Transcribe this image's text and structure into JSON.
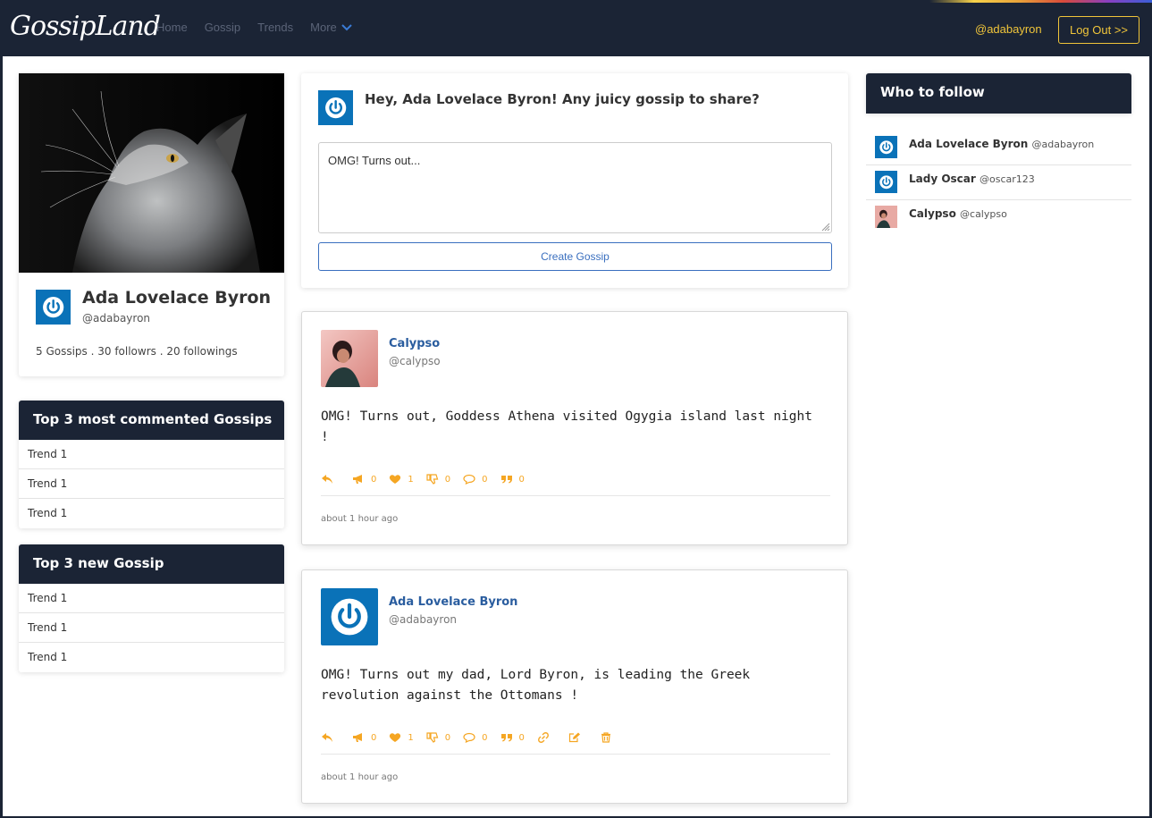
{
  "navbar": {
    "brand": "GossipLand",
    "links": [
      "Home",
      "Gossip",
      "Trends",
      "More"
    ],
    "user": "@adabayron",
    "logout": "Log Out >>"
  },
  "profile": {
    "name": "Ada Lovelace Byron",
    "handle": "@adabayron",
    "stats": "5 Gossips . 30 followrs . 20 followings"
  },
  "most_commented": {
    "title": "Top 3 most commented Gossips",
    "items": [
      "Trend 1",
      "Trend 1",
      "Trend 1"
    ]
  },
  "new_gossip": {
    "title": "Top 3 new Gossip",
    "items": [
      "Trend 1",
      "Trend 1",
      "Trend 1"
    ]
  },
  "compose": {
    "prompt": "Hey, Ada Lovelace Byron! Any juicy gossip to share?",
    "value": "OMG! Turns out...",
    "button": "Create Gossip"
  },
  "posts": [
    {
      "author": "Calypso",
      "handle": "@calypso",
      "body": "OMG! Turns out, Goddess Athena visited Ogygia island last night !",
      "counts": {
        "share": "0",
        "like": "1",
        "dislike": "0",
        "comment": "0",
        "quote": "0"
      },
      "time": "about 1 hour ago"
    },
    {
      "author": "Ada Lovelace Byron",
      "handle": "@adabayron",
      "body": "OMG! Turns out my dad, Lord Byron, is leading the Greek revolution against the Ottomans !",
      "counts": {
        "share": "0",
        "like": "1",
        "dislike": "0",
        "comment": "0",
        "quote": "0"
      },
      "time": "about 1 hour ago"
    }
  ],
  "who_to_follow": {
    "title": "Who to follow",
    "users": [
      {
        "name": "Ada Lovelace Byron",
        "handle": "@adabayron"
      },
      {
        "name": "Lady Oscar",
        "handle": "@oscar123"
      },
      {
        "name": "Calypso",
        "handle": "@calypso"
      }
    ]
  },
  "colors": {
    "navbar": "#1b2435",
    "accent": "#f0c53a",
    "action": "#f5a623",
    "link": "#2a5d9f",
    "avatar_blue": "#0a72b8"
  }
}
